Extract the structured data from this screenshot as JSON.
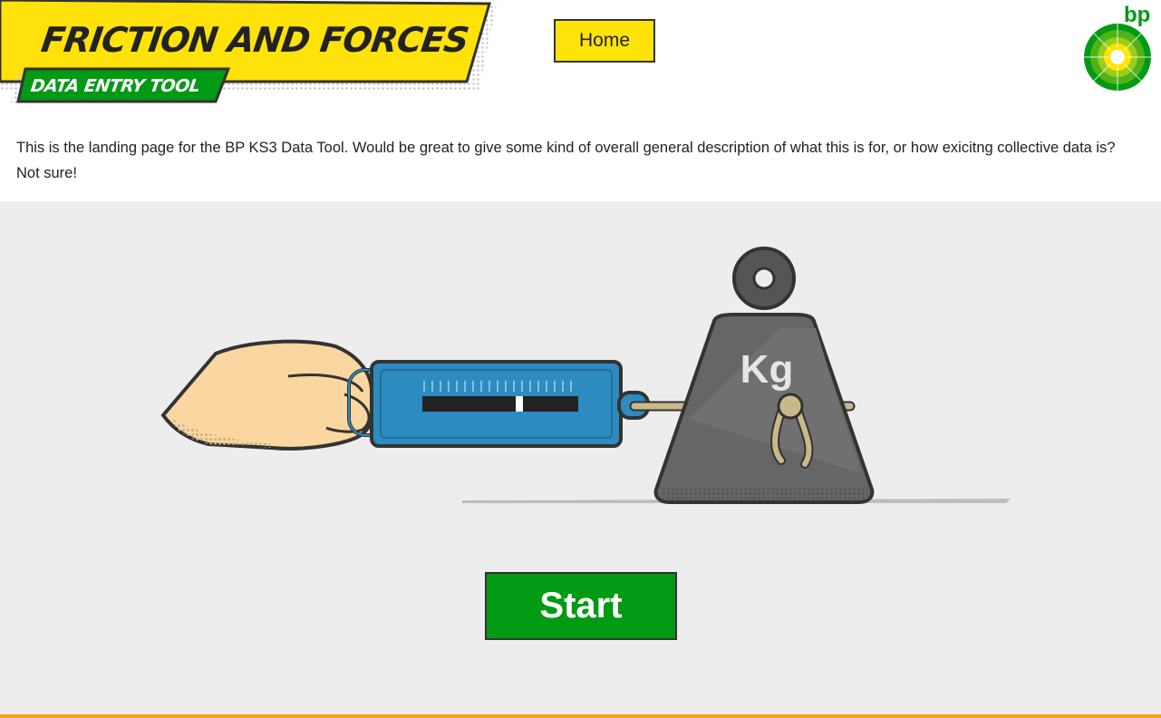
{
  "header": {
    "title": "FRICTION AND FORCES",
    "subtitle": "DATA ENTRY TOOL",
    "home_label": "Home",
    "logo_text": "bp"
  },
  "intro": {
    "text": "This is the landing page for the BP KS3 Data Tool. Would be great to give some kind of overall general description of what this is for, or how exicitng collective data is? Not sure!"
  },
  "illustration": {
    "weight_label": "Kg"
  },
  "actions": {
    "start_label": "Start"
  },
  "colors": {
    "yellow": "#ffe20a",
    "green": "#009a14",
    "meter_blue": "#2e8bbf",
    "weight_grey": "#666666",
    "accent_orange": "#f7a11a"
  }
}
